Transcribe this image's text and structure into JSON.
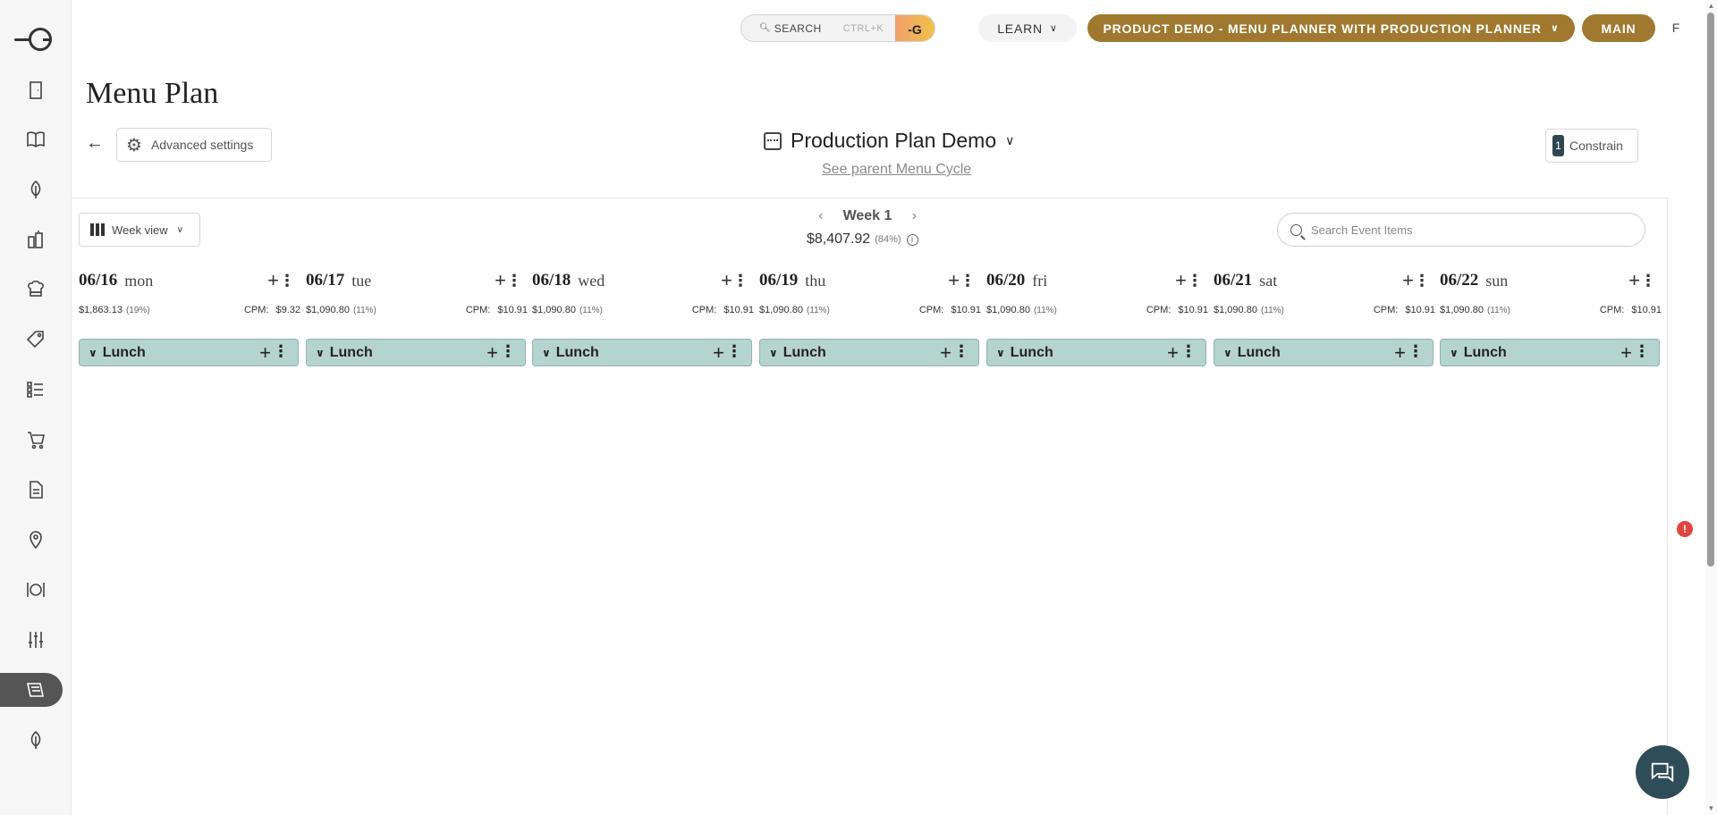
{
  "topbar": {
    "search_label": "SEARCH",
    "search_shortcut": "CTRL+K",
    "learn_label": "LEARN",
    "product_label": "PRODUCT DEMO - MENU PLANNER WITH PRODUCTION PLANNER",
    "main_label": "MAIN",
    "user_initial": "F"
  },
  "sidebar": {
    "items": [
      {
        "icon": "door-icon"
      },
      {
        "icon": "book-icon"
      },
      {
        "icon": "leaf-icon"
      },
      {
        "icon": "bottles-icon"
      },
      {
        "icon": "chef-icon"
      },
      {
        "icon": "tag-icon"
      },
      {
        "icon": "checklist-icon"
      },
      {
        "icon": "cart-icon"
      },
      {
        "icon": "document-icon"
      },
      {
        "icon": "location-icon"
      },
      {
        "icon": "dining-icon"
      },
      {
        "icon": "sliders-icon"
      },
      {
        "icon": "menu-plan-icon",
        "active": true
      },
      {
        "icon": "leaf-icon"
      }
    ]
  },
  "header": {
    "page_title": "Menu Plan",
    "advanced_settings": "Advanced settings",
    "plan_name": "Production Plan Demo",
    "parent_link": "See parent Menu Cycle",
    "constrain_count": "1",
    "constrain_label": "Constrain"
  },
  "planner": {
    "view_label": "Week view",
    "week_label": "Week 1",
    "week_total": "$8,407.92",
    "week_pct": "(84%)",
    "search_placeholder": "Search Event Items",
    "days": [
      {
        "date": "06/16",
        "name": "mon",
        "cost": "$1,863.13",
        "pct": "(19%)",
        "cpm_label": "CPM:",
        "cpm": "$9.32",
        "meal": "Lunch"
      },
      {
        "date": "06/17",
        "name": "tue",
        "cost": "$1,090.80",
        "pct": "(11%)",
        "cpm_label": "CPM:",
        "cpm": "$10.91",
        "meal": "Lunch"
      },
      {
        "date": "06/18",
        "name": "wed",
        "cost": "$1,090.80",
        "pct": "(11%)",
        "cpm_label": "CPM:",
        "cpm": "$10.91",
        "meal": "Lunch"
      },
      {
        "date": "06/19",
        "name": "thu",
        "cost": "$1,090.80",
        "pct": "(11%)",
        "cpm_label": "CPM:",
        "cpm": "$10.91",
        "meal": "Lunch"
      },
      {
        "date": "06/20",
        "name": "fri",
        "cost": "$1,090.80",
        "pct": "(11%)",
        "cpm_label": "CPM:",
        "cpm": "$10.91",
        "meal": "Lunch"
      },
      {
        "date": "06/21",
        "name": "sat",
        "cost": "$1,090.80",
        "pct": "(11%)",
        "cpm_label": "CPM:",
        "cpm": "$10.91",
        "meal": "Lunch"
      },
      {
        "date": "06/22",
        "name": "sun",
        "cost": "$1,090.80",
        "pct": "(11%)",
        "cpm_label": "CPM:",
        "cpm": "$10.91",
        "meal": "Lunch"
      }
    ]
  },
  "colors": {
    "brand_gold": "#a0782f",
    "meal_bg": "#b5d3cf",
    "chat_bg": "#2f4d58",
    "alert_red": "#e0453d"
  }
}
